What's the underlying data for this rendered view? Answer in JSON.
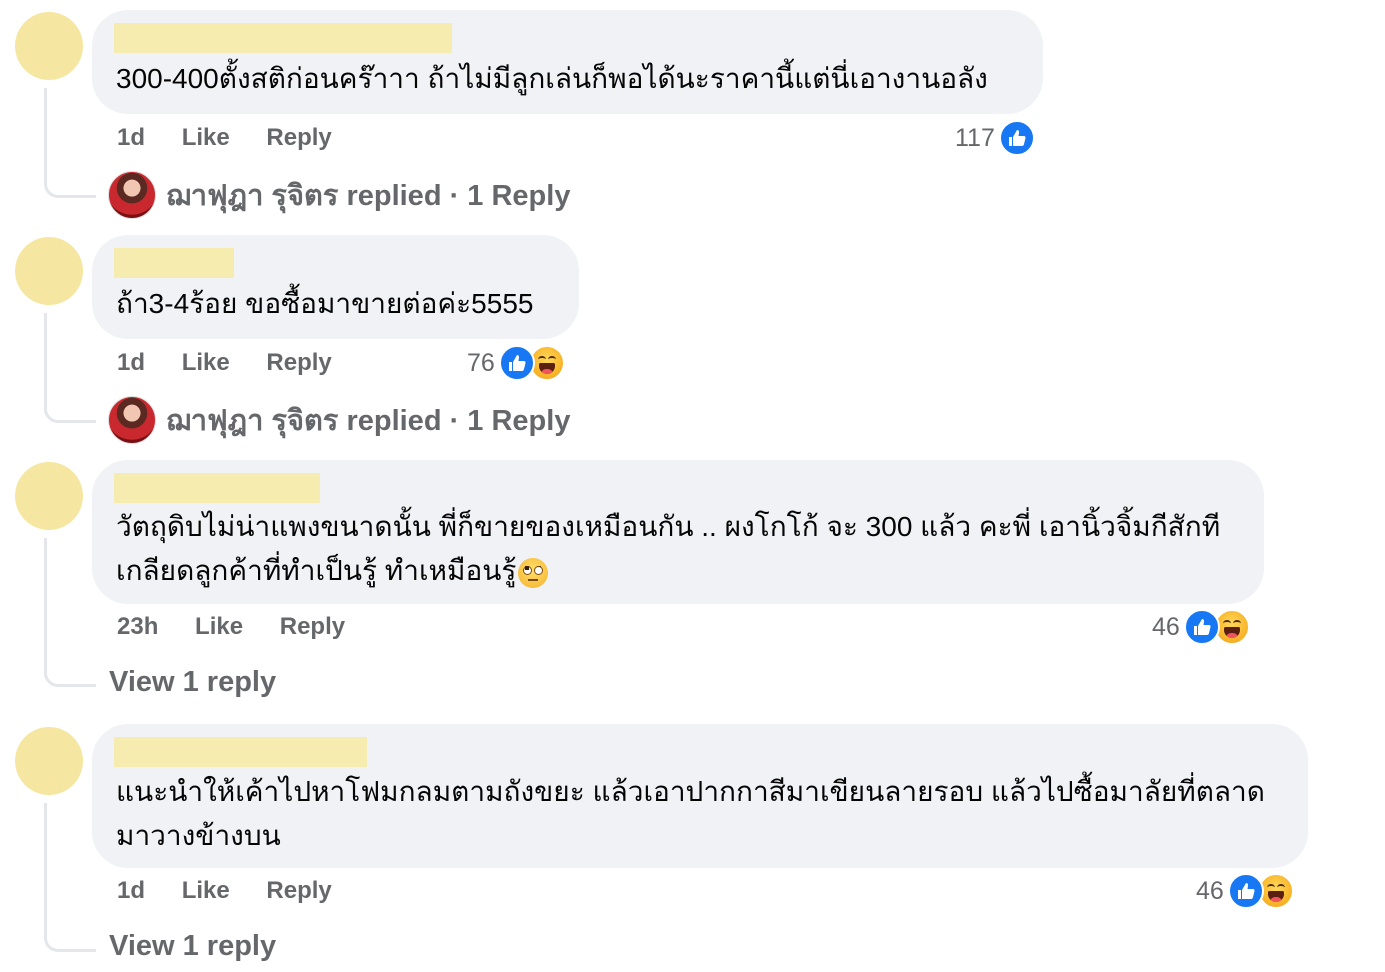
{
  "colors": {
    "like_blue": "#1877f2",
    "bubble_bg": "#f0f2f5",
    "meta_gray": "#65676b",
    "redaction": "#f7ecb0"
  },
  "comments": [
    {
      "text": "300-400ตั้งสติก่อนคร๊าาา ถ้าไม่มีลูกเล่นก็พอได้นะราคานี้แต่นี่เอางานอลัง",
      "time": "1d",
      "like": "Like",
      "reply": "Reply",
      "count": "117",
      "reactions": [
        "like-icon"
      ],
      "replied_by": "ฌาฟุฎา รุจิตร replied · 1 Reply"
    },
    {
      "text": "ถ้า3-4ร้อย ขอซื้อมาขายต่อค่ะ5555",
      "time": "1d",
      "like": "Like",
      "reply": "Reply",
      "count": "76",
      "reactions": [
        "like-icon",
        "haha-icon"
      ],
      "replied_by": "ฌาฟุฎา รุจิตร replied · 1 Reply"
    },
    {
      "text_line1": "วัตถุดิบไม่น่าแพงขนาดนั้น พี่ก็ขายของเหมือนกัน .. ผงโกโก้ จะ 300 แล้ว คะพี่ เอานิ้วจิ้มกีสักที",
      "text_line2": "เกลียดลูกค้าที่ทำเป็นรู้ ทำเหมือนรู้",
      "emoji": "face-with-rolling-eyes-icon",
      "time": "23h",
      "like": "Like",
      "reply": "Reply",
      "count": "46",
      "reactions": [
        "like-icon",
        "haha-icon"
      ],
      "view_reply": "View 1 reply"
    },
    {
      "text_line1": "แนะนำให้เค้าไปหาโฟมกลมตามถังขยะ แล้วเอาปากกาสีมาเขียนลายรอบ แล้วไปซื้อมาลัยที่ตลาด",
      "text_line2": "มาวางข้างบน",
      "time": "1d",
      "like": "Like",
      "reply": "Reply",
      "count": "46",
      "reactions": [
        "like-icon",
        "haha-icon"
      ],
      "view_reply": "View 1 reply"
    }
  ]
}
